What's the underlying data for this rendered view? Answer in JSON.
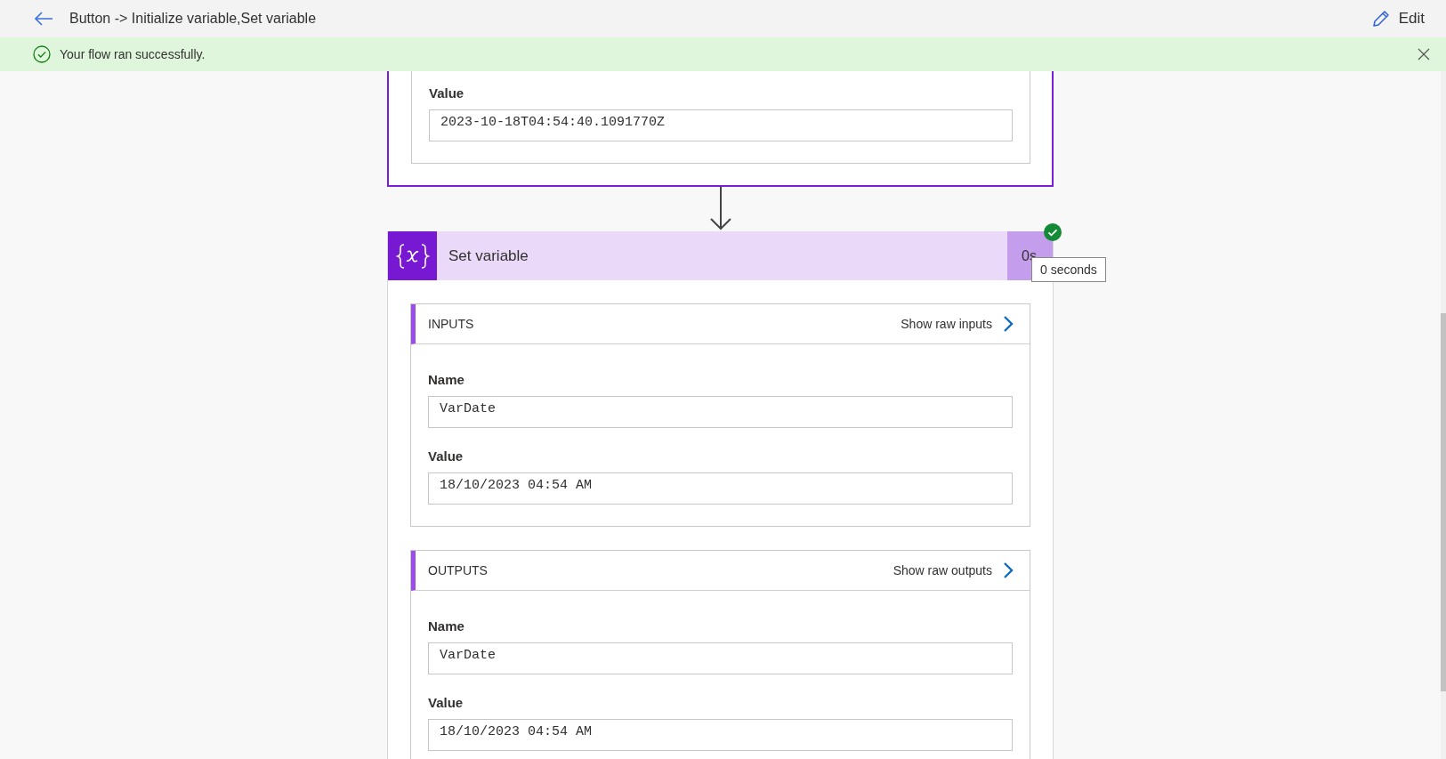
{
  "header": {
    "title": "Button -> Initialize variable,Set variable",
    "edit_label": "Edit"
  },
  "banner": {
    "message": "Your flow ran successfully."
  },
  "previous_step": {
    "selected": true,
    "fields": [
      {
        "label": "Value",
        "value": "2023-10-18T04:54:40.1091770Z"
      }
    ]
  },
  "step": {
    "title": "Set variable",
    "duration": "0s",
    "succeeded": true,
    "tooltip": "0 seconds",
    "sections": [
      {
        "heading": "INPUTS",
        "raw_link": "Show raw inputs",
        "fields": [
          {
            "label": "Name",
            "value": "VarDate"
          },
          {
            "label": "Value",
            "value": "18/10/2023 04:54 AM"
          }
        ]
      },
      {
        "heading": "OUTPUTS",
        "raw_link": "Show raw outputs",
        "fields": [
          {
            "label": "Name",
            "value": "VarDate"
          },
          {
            "label": "Value",
            "value": "18/10/2023 04:54 AM"
          }
        ]
      }
    ]
  }
}
